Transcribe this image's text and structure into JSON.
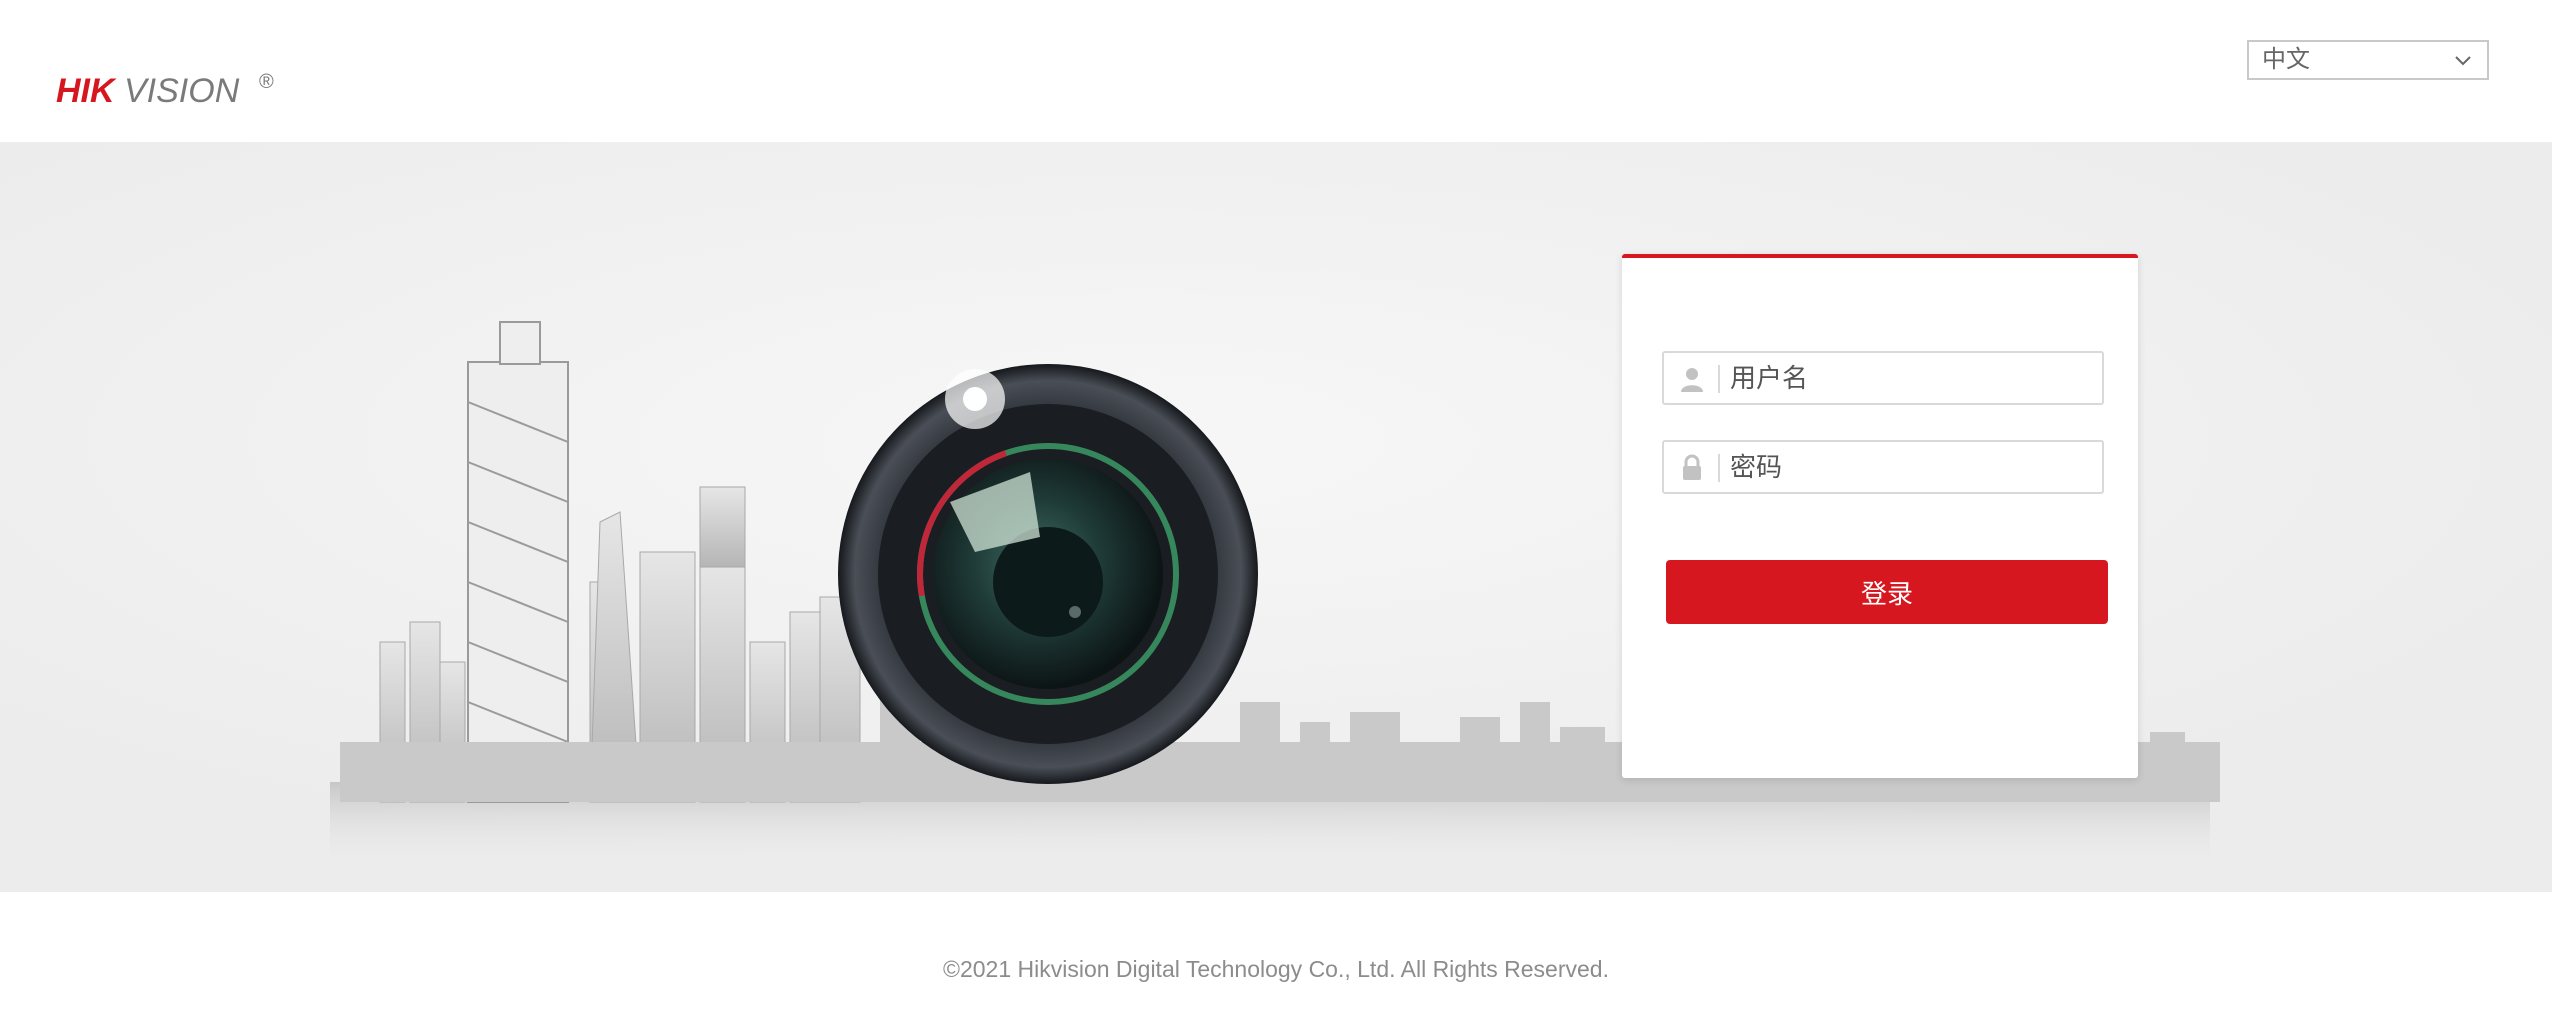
{
  "brand": {
    "name": "HIKVISION",
    "registered_mark": "®",
    "accent_color": "#d7171f"
  },
  "language": {
    "selected": "中文",
    "options": [
      "中文"
    ]
  },
  "login": {
    "username_placeholder": "用户名",
    "password_placeholder": "密码",
    "submit_label": "登录"
  },
  "icons": {
    "user": "user-icon",
    "lock": "lock-icon",
    "chevron": "chevron-down-icon"
  },
  "footer": {
    "copyright": "©2021 Hikvision Digital Technology Co., Ltd. All Rights Reserved."
  }
}
